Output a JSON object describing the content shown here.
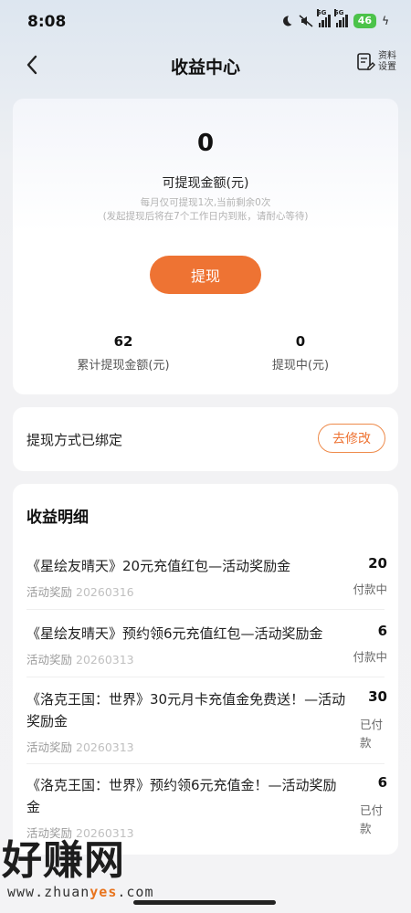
{
  "status_bar": {
    "time": "8:08",
    "network_1": "5G",
    "network_2": "5G",
    "battery": "46"
  },
  "header": {
    "title": "收益中心",
    "profile_settings_line1": "资料",
    "profile_settings_line2": "设置"
  },
  "balance": {
    "amount": "0",
    "label": "可提现金额(元)",
    "hint_line1": "每月仅可提现1次,当前剩余0次",
    "hint_line2": "(发起提现后将在7个工作日内到账，请耐心等待)",
    "withdraw_label": "提现",
    "total_withdrawn_value": "62",
    "total_withdrawn_label": "累计提现金额(元)",
    "withdrawing_value": "0",
    "withdrawing_label": "提现中(元)"
  },
  "binding": {
    "text": "提现方式已绑定",
    "modify_label": "去修改"
  },
  "details": {
    "title": "收益明细",
    "records": [
      {
        "title": "《星绘友晴天》20元充值红包—活动奖励金",
        "source": "活动奖励",
        "date": "20260316",
        "amount": "20",
        "status": "付款中"
      },
      {
        "title": "《星绘友晴天》预约领6元充值红包—活动奖励金",
        "source": "活动奖励",
        "date": "20260313",
        "amount": "6",
        "status": "付款中"
      },
      {
        "title": "《洛克王国：世界》30元月卡充值金免费送！—活动奖励金",
        "source": "活动奖励",
        "date": "20260313",
        "amount": "30",
        "status": "已付款"
      },
      {
        "title": "《洛克王国：世界》预约领6元充值金！—活动奖励金",
        "source": "活动奖励",
        "date": "20260313",
        "amount": "6",
        "status": "已付款"
      }
    ]
  },
  "watermark": {
    "big": "好赚网",
    "small_pre": "www.zhuan",
    "small_hl": "yes",
    "small_post": ".com"
  },
  "colors": {
    "accent": "#ee7333",
    "battery": "#4cc34a"
  }
}
